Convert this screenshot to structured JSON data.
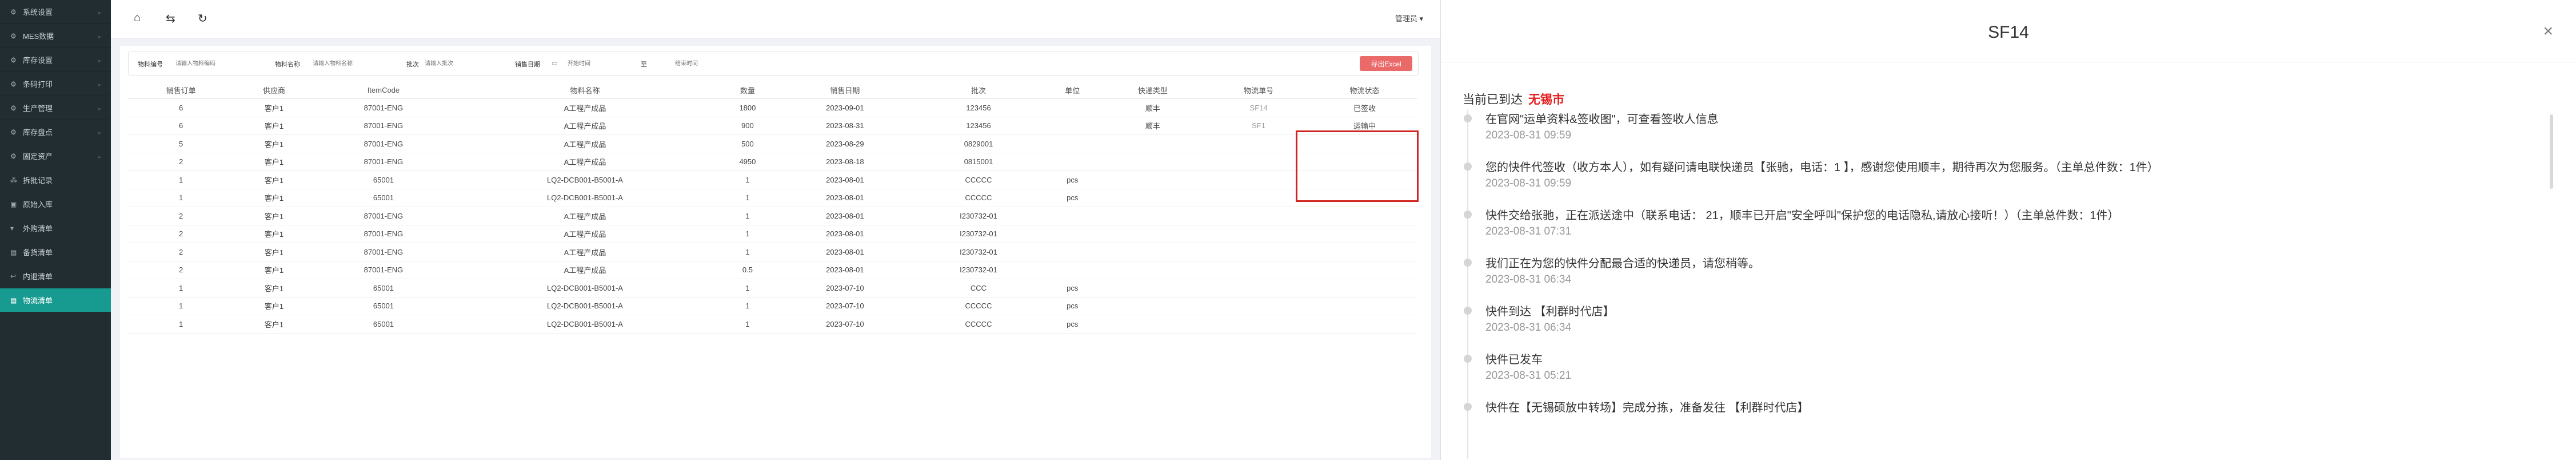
{
  "sidebar": {
    "items": [
      {
        "label": "系统设置",
        "icon": "gear-icon",
        "glyph": "⚙"
      },
      {
        "label": "MES数据",
        "icon": "gear-icon",
        "glyph": "⚙"
      },
      {
        "label": "库存设置",
        "icon": "gear-icon",
        "glyph": "⚙"
      },
      {
        "label": "条码打印",
        "icon": "gear-icon",
        "glyph": "⚙"
      },
      {
        "label": "生产管理",
        "icon": "gear-icon",
        "glyph": "⚙"
      },
      {
        "label": "库存盘点",
        "icon": "gear-icon",
        "glyph": "⚙"
      },
      {
        "label": "固定资产",
        "icon": "gear-icon",
        "glyph": "⚙"
      },
      {
        "label": "拆批记录",
        "icon": "split-icon",
        "glyph": "⁂"
      },
      {
        "label": "原始入库",
        "icon": "inbox-icon",
        "glyph": "▣"
      },
      {
        "label": "外购清单",
        "icon": "cart-icon",
        "glyph": "▾"
      },
      {
        "label": "备货清单",
        "icon": "doc-icon",
        "glyph": "▤"
      },
      {
        "label": "内退清单",
        "icon": "return-icon",
        "glyph": "↩"
      },
      {
        "label": "物流清单",
        "icon": "truck-icon",
        "glyph": "▤"
      }
    ]
  },
  "topbar": {
    "home_icon": "⌂",
    "fold_icon": "⇆",
    "refresh_icon": "↻",
    "user": "管理员 ▾"
  },
  "filters": {
    "material_code_label": "物料编号",
    "material_code_ph": "请输入物料编码",
    "material_name_label": "物料名称",
    "material_name_ph": "请输入物料名称",
    "batch_label": "批次",
    "batch_ph": "请输入批次",
    "date_label": "销售日期",
    "date_start_ph": "开始时间",
    "date_sep": "至",
    "date_end_ph": "结束时间",
    "export_label": "导出Excel"
  },
  "table": {
    "headers": [
      "销售订单",
      "供应商",
      "ItemCode",
      "物料名称",
      "数量",
      "销售日期",
      "批次",
      "单位",
      "快递类型",
      "物流单号",
      "物流状态"
    ],
    "rows": [
      [
        "6",
        "客户1",
        "87001-ENG",
        "A工程产成品",
        "1800",
        "2023-09-01",
        "123456",
        "",
        "顺丰",
        "SF14",
        "已签收"
      ],
      [
        "6",
        "客户1",
        "87001-ENG",
        "A工程产成品",
        "900",
        "2023-08-31",
        "123456",
        "",
        "顺丰",
        "SF1",
        "运输中"
      ],
      [
        "5",
        "客户1",
        "87001-ENG",
        "A工程产成品",
        "500",
        "2023-08-29",
        "0829001",
        "",
        "",
        "",
        ""
      ],
      [
        "2",
        "客户1",
        "87001-ENG",
        "A工程产成品",
        "4950",
        "2023-08-18",
        "0815001",
        "",
        "",
        "",
        ""
      ],
      [
        "1",
        "客户1",
        "65001",
        "LQ2-DCB001-B5001-A",
        "1",
        "2023-08-01",
        "CCCCC",
        "pcs",
        "",
        "",
        ""
      ],
      [
        "1",
        "客户1",
        "65001",
        "LQ2-DCB001-B5001-A",
        "1",
        "2023-08-01",
        "CCCCC",
        "pcs",
        "",
        "",
        ""
      ],
      [
        "2",
        "客户1",
        "87001-ENG",
        "A工程产成品",
        "1",
        "2023-08-01",
        "I230732-01",
        "",
        "",
        "",
        ""
      ],
      [
        "2",
        "客户1",
        "87001-ENG",
        "A工程产成品",
        "1",
        "2023-08-01",
        "I230732-01",
        "",
        "",
        "",
        ""
      ],
      [
        "2",
        "客户1",
        "87001-ENG",
        "A工程产成品",
        "1",
        "2023-08-01",
        "I230732-01",
        "",
        "",
        "",
        ""
      ],
      [
        "2",
        "客户1",
        "87001-ENG",
        "A工程产成品",
        "0.5",
        "2023-08-01",
        "I230732-01",
        "",
        "",
        "",
        ""
      ],
      [
        "1",
        "客户1",
        "65001",
        "LQ2-DCB001-B5001-A",
        "1",
        "2023-07-10",
        "CCC",
        "pcs",
        "",
        "",
        ""
      ],
      [
        "1",
        "客户1",
        "65001",
        "LQ2-DCB001-B5001-A",
        "1",
        "2023-07-10",
        "CCCCC",
        "pcs",
        "",
        "",
        ""
      ],
      [
        "1",
        "客户1",
        "65001",
        "LQ2-DCB001-B5001-A",
        "1",
        "2023-07-10",
        "CCCCC",
        "pcs",
        "",
        "",
        ""
      ]
    ]
  },
  "panel": {
    "title": "SF14",
    "close_icon": "×",
    "current_label": "当前已到达",
    "current_city": "无锡市",
    "events": [
      {
        "text": "在官网\"运单资料&签收图\"，可查看签收人信息",
        "time": "2023-08-31 09:59"
      },
      {
        "text": "您的快件代签收（收方本人），如有疑问请电联快递员【张驰，电话：1             】，感谢您使用顺丰，期待再次为您服务。（主单总件数：1件）",
        "time": "2023-08-31 09:59"
      },
      {
        "text": "快件交给张驰，正在派送途中（联系电话：                21，顺丰已开启\"安全呼叫\"保护您的电话隐私,请放心接听！）（主单总件数：1件）",
        "time": "2023-08-31 07:31"
      },
      {
        "text": "我们正在为您的快件分配最合适的快递员，请您稍等。",
        "time": "2023-08-31 06:34"
      },
      {
        "text": "快件到达 【利群时代店】",
        "time": "2023-08-31 06:34"
      },
      {
        "text": "快件已发车",
        "time": "2023-08-31 05:21"
      },
      {
        "text": "快件在【无锡硕放中转场】完成分拣，准备发往 【利群时代店】",
        "time": ""
      }
    ]
  }
}
